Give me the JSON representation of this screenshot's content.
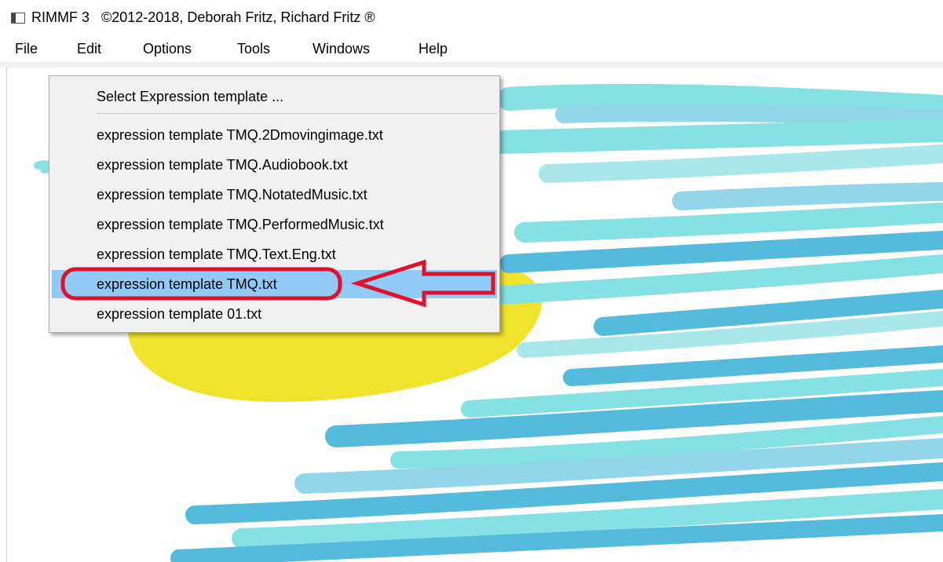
{
  "window": {
    "title": "RIMMF 3   ©2012-2018, Deborah Fritz, Richard Fritz ®"
  },
  "menubar": {
    "items": [
      {
        "label": "File"
      },
      {
        "label": "Edit"
      },
      {
        "label": "Options"
      },
      {
        "label": "Tools"
      },
      {
        "label": "Windows"
      },
      {
        "label": "Help"
      }
    ]
  },
  "popup": {
    "header": "Select Expression template ...",
    "items": [
      {
        "label": "expression template TMQ.2Dmovingimage.txt"
      },
      {
        "label": "expression template TMQ.Audiobook.txt"
      },
      {
        "label": "expression template TMQ.NotatedMusic.txt"
      },
      {
        "label": "expression template TMQ.PerformedMusic.txt"
      },
      {
        "label": "expression template TMQ.Text.Eng.txt"
      },
      {
        "label": "expression template TMQ.txt"
      },
      {
        "label": "expression template 01.txt"
      }
    ],
    "highlighted_label": "expression template TMQ.txt"
  },
  "colors": {
    "highlight": "#91c9f7",
    "annotation_red": "#e0112b",
    "scribble_cyan": "#7fe0e3",
    "scribble_blue": "#4cb8dc",
    "scribble_yellow": "#f0e221"
  },
  "icons": {
    "app_icon": "window-app-icon",
    "annotation_arrow": "left-arrow-annotation"
  }
}
